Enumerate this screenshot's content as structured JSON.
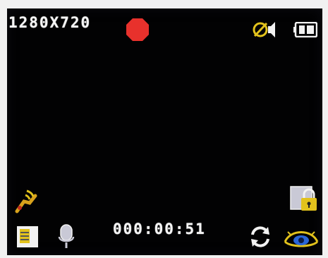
{
  "osd": {
    "resolution": "1280X720",
    "recording_time": "000:00:51",
    "recording_indicator_color": "#e8312c",
    "accent_yellow": "#e2c21c",
    "accent_blue": "#2a66d6"
  },
  "icons": {
    "record": "record-dot-icon",
    "sound_off": "speaker-muted-icon",
    "battery": "battery-icon",
    "motion": "motion-detect-icon",
    "lock": "file-lock-icon",
    "sd_card": "sd-card-icon",
    "microphone": "microphone-icon",
    "loop": "loop-recording-icon",
    "eye": "eye-icon"
  }
}
